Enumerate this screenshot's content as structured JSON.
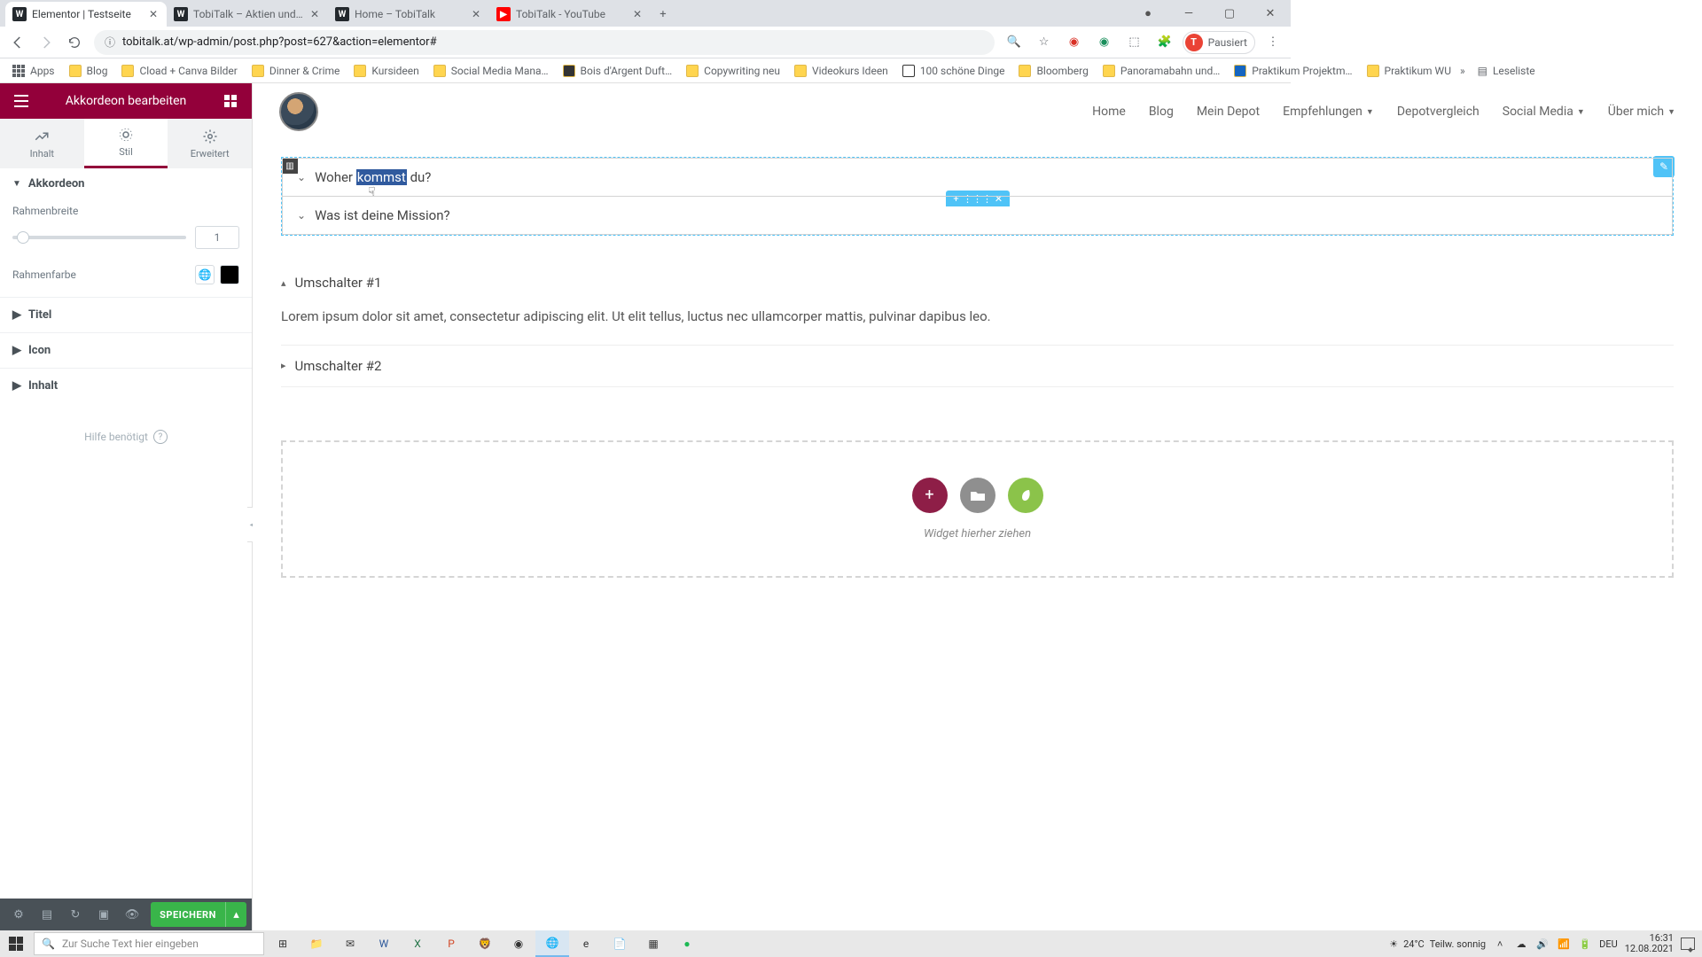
{
  "browser": {
    "tabs": [
      {
        "title": "Elementor | Testseite",
        "favicon": "W",
        "favcolor": "#23282d",
        "active": true
      },
      {
        "title": "TobiTalk – Aktien und persönliche",
        "favicon": "W",
        "favcolor": "#23282d",
        "active": false
      },
      {
        "title": "Home – TobiTalk",
        "favicon": "W",
        "favcolor": "#23282d",
        "active": false
      },
      {
        "title": "TobiTalk - YouTube",
        "favicon": "▶",
        "favcolor": "#ff0000",
        "active": false
      }
    ],
    "url": "tobitalk.at/wp-admin/post.php?post=627&action=elementor#",
    "profile": {
      "letter": "T",
      "label": "Pausiert"
    }
  },
  "bookmarks": [
    {
      "label": "Apps",
      "icon": "grid"
    },
    {
      "label": "Blog"
    },
    {
      "label": "Cload + Canva Bilder"
    },
    {
      "label": "Dinner & Crime"
    },
    {
      "label": "Kursideen"
    },
    {
      "label": "Social Media Mana…"
    },
    {
      "label": "Bois d'Argent Duft…"
    },
    {
      "label": "Copywriting neu"
    },
    {
      "label": "Videokurs Ideen"
    },
    {
      "label": "100 schöne Dinge"
    },
    {
      "label": "Bloomberg"
    },
    {
      "label": "Panoramabahn und…"
    },
    {
      "label": "Praktikum Projektm…"
    },
    {
      "label": "Praktikum WU"
    }
  ],
  "bookmarks_overflow": "Leseliste",
  "elementor": {
    "header_title": "Akkordeon bearbeiten",
    "tabs": {
      "content": "Inhalt",
      "style": "Stil",
      "advanced": "Erweitert"
    },
    "section_title": "Akkordeon",
    "controls": {
      "border_width_label": "Rahmenbreite",
      "border_width_value": "1",
      "border_color_label": "Rahmenfarbe",
      "collapse_title": "Titel",
      "collapse_icon": "Icon",
      "collapse_content": "Inhalt"
    },
    "help": "Hilfe benötigt",
    "save": "SPEICHERN"
  },
  "site_nav": [
    "Home",
    "Blog",
    "Mein Depot",
    "Empfehlungen",
    "Depotvergleich",
    "Social Media",
    "Über mich"
  ],
  "site_nav_dropdown_indices": [
    3,
    5,
    6
  ],
  "accordion": {
    "items": [
      {
        "pre": "Woher ",
        "hi": "kommst",
        "post": " du?"
      },
      {
        "pre": "Was ist deine Mission?",
        "hi": "",
        "post": ""
      }
    ]
  },
  "toggle": {
    "items": [
      {
        "title": "Umschalter #1",
        "open": true,
        "content": "Lorem ipsum dolor sit amet, consectetur adipiscing elit. Ut elit tellus, luctus nec ullamcorper mattis, pulvinar dapibus leo."
      },
      {
        "title": "Umschalter #2",
        "open": false,
        "content": ""
      }
    ]
  },
  "dropzone_text": "Widget hierher ziehen",
  "taskbar": {
    "search_placeholder": "Zur Suche Text hier eingeben",
    "weather": {
      "temp": "24°C",
      "desc": "Teilw. sonnig"
    },
    "lang": "DEU",
    "time": "16:31",
    "date": "12.08.2021"
  }
}
